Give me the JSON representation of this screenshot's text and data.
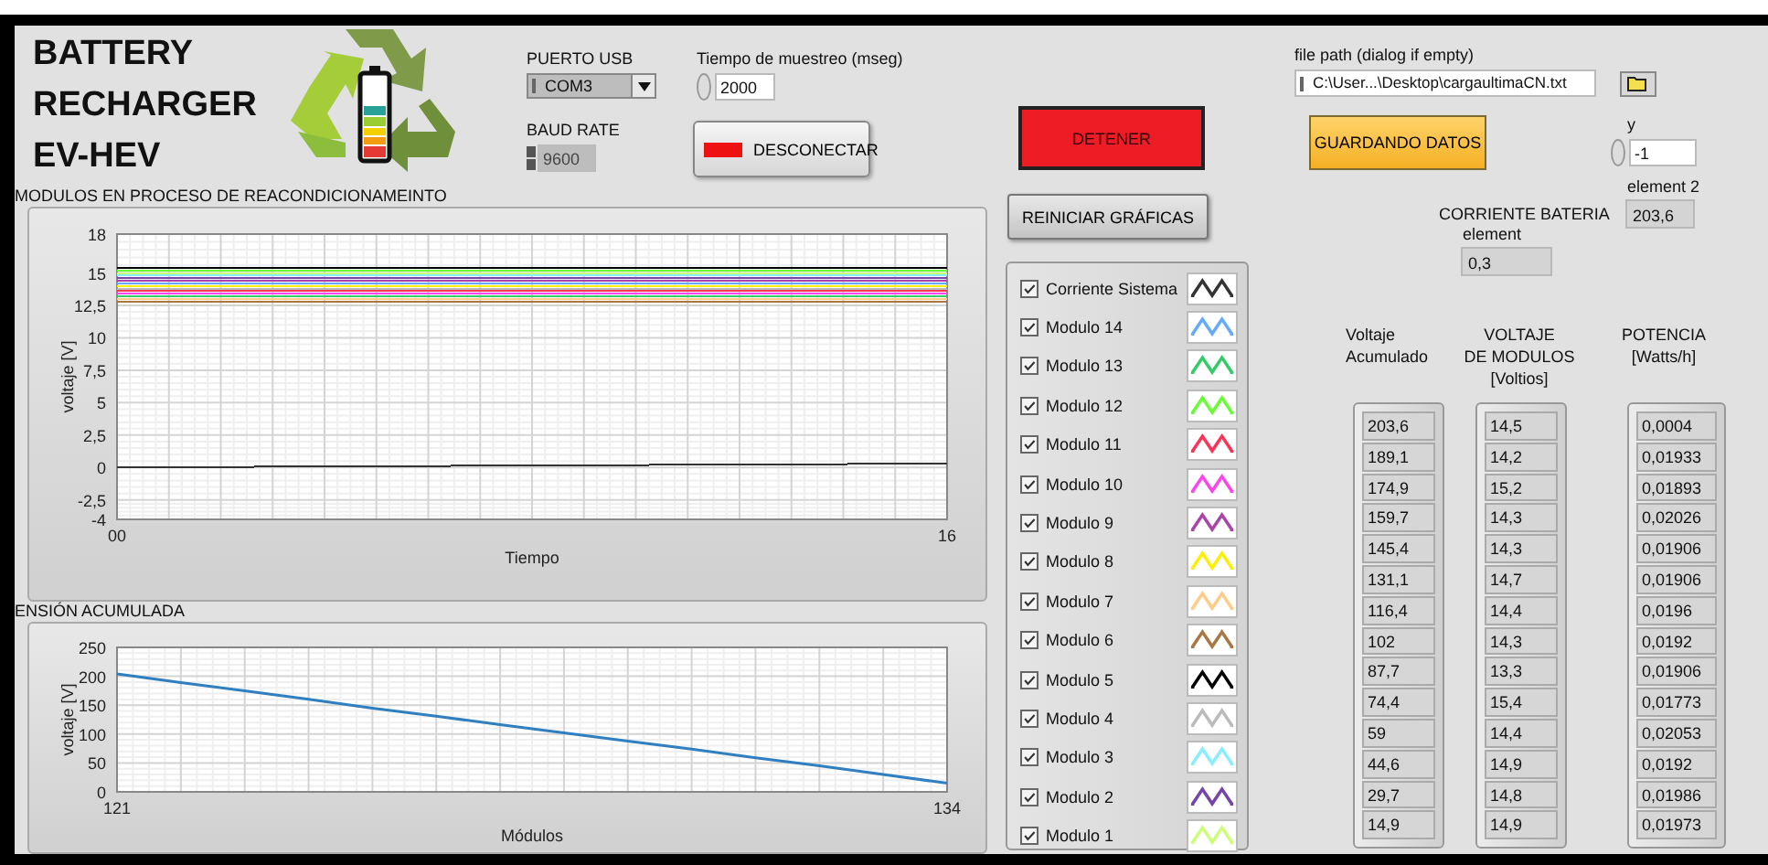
{
  "header": {
    "title": "BATTERY RECHARGER EV-HEV"
  },
  "serial": {
    "port_label": "PUERTO USB",
    "port": "COM3",
    "baud_label": "BAUD RATE",
    "baud": "9600",
    "baud_disabled": true
  },
  "sampling": {
    "label": "Tiempo de muestreo (mseg)",
    "value": "2000"
  },
  "disconnect_button": {
    "label": "DESCONECTAR",
    "on": true
  },
  "stop_button": {
    "label": "DETENER"
  },
  "reset_button": {
    "label": "REINICIAR GRÁFICAS"
  },
  "module_chart": {
    "chart_data": {
      "type": "line",
      "title": "MODULOS EN PROCESO DE REACONDICIONAMEINTO",
      "xlabel": "Tiempo",
      "ylabel": "voltaje [V]",
      "grid": true,
      "x": [
        0,
        16
      ],
      "xlim": [
        0,
        16
      ],
      "ylim": [
        -4,
        18
      ],
      "xticks": [
        {
          "value": 0,
          "label": "00"
        },
        16
      ],
      "yticks": [
        {
          "value": -4,
          "label": "-4"
        },
        {
          "value": -2.5,
          "label": "-2,5"
        },
        0,
        {
          "value": 2.5,
          "label": "2,5"
        },
        5,
        {
          "value": 7.5,
          "label": "7,5"
        },
        10,
        {
          "value": 12.5,
          "label": "12,5"
        },
        15,
        18
      ],
      "series": [
        {
          "color": "#333333",
          "values": [
            0,
            0.3
          ]
        },
        {
          "color": "#66aaff",
          "values": [
            14.2,
            14.2
          ]
        },
        {
          "color": "#33cc66",
          "values": [
            13.2,
            13.2
          ]
        },
        {
          "color": "#66ff33",
          "values": [
            15.2,
            15.2
          ]
        },
        {
          "color": "#ff3355",
          "values": [
            13.6,
            13.6
          ]
        },
        {
          "color": "#ff44ee",
          "values": [
            13.4,
            13.4
          ]
        },
        {
          "color": "#aa44aa",
          "values": [
            14.4,
            14.4
          ]
        },
        {
          "color": "#ffee00",
          "values": [
            14.0,
            14.0
          ]
        },
        {
          "color": "#ffcc88",
          "values": [
            13.0,
            13.0
          ]
        },
        {
          "color": "#aa7744",
          "values": [
            12.8,
            12.8
          ]
        },
        {
          "color": "#000000",
          "values": [
            15.4,
            15.4
          ]
        },
        {
          "color": "#bbbbbb",
          "values": [
            13.8,
            13.8
          ]
        },
        {
          "color": "#88eeff",
          "values": [
            14.8,
            14.8
          ]
        },
        {
          "color": "#7744aa",
          "values": [
            14.6,
            14.6
          ]
        },
        {
          "color": "#ccff77",
          "values": [
            15.0,
            15.0
          ]
        }
      ]
    }
  },
  "accumulated_chart": {
    "chart_data": {
      "type": "line",
      "title": "ENSIÓN ACUMULADA",
      "xlabel": "Módulos",
      "ylabel": "voltaje [V]",
      "grid": true,
      "x": [
        121,
        122,
        123,
        124,
        125,
        126,
        127,
        128,
        129,
        130,
        131,
        132,
        133,
        134
      ],
      "xlim": [
        121,
        134
      ],
      "ylim": [
        0,
        250
      ],
      "xticks": [
        121,
        134
      ],
      "yticks": [
        0,
        50,
        100,
        150,
        200,
        250
      ],
      "series": [
        {
          "color": "#2f7fc1",
          "values": [
            204,
            189,
            175,
            160,
            145,
            131,
            116,
            102,
            88,
            74,
            59,
            45,
            30,
            15
          ]
        }
      ]
    }
  },
  "legend": {
    "items": [
      {
        "label": "Corriente Sistema",
        "checked": true,
        "color": "#333333"
      },
      {
        "label": "Modulo 14",
        "checked": true,
        "color": "#66aaff"
      },
      {
        "label": "Modulo 13",
        "checked": true,
        "color": "#33cc66"
      },
      {
        "label": "Modulo 12",
        "checked": true,
        "color": "#66ff33"
      },
      {
        "label": "Modulo 11",
        "checked": true,
        "color": "#ff3355"
      },
      {
        "label": "Modulo 10",
        "checked": true,
        "color": "#ff44ee"
      },
      {
        "label": "Modulo 9",
        "checked": true,
        "color": "#aa44aa"
      },
      {
        "label": "Modulo 8",
        "checked": true,
        "color": "#ffee00"
      },
      {
        "label": "Modulo 7",
        "checked": true,
        "color": "#ffcc88"
      },
      {
        "label": "Modulo 6",
        "checked": true,
        "color": "#aa7744"
      },
      {
        "label": "Modulo 5",
        "checked": true,
        "color": "#000000"
      },
      {
        "label": "Modulo 4",
        "checked": true,
        "color": "#bbbbbb"
      },
      {
        "label": "Modulo 3",
        "checked": true,
        "color": "#88eeff"
      },
      {
        "label": "Modulo 2",
        "checked": true,
        "color": "#7744aa"
      },
      {
        "label": "Modulo 1",
        "checked": true,
        "color": "#ccff77"
      }
    ]
  },
  "file_path": {
    "label": "file path (dialog if empty)",
    "value": "C:\\User...\\Desktop\\cargaultimaCN.txt"
  },
  "save_button": {
    "label": "GUARDANDO DATOS",
    "on": true
  },
  "y_control": {
    "label": "y",
    "value": "-1"
  },
  "element_2": {
    "label": "element 2",
    "value": "203,6"
  },
  "battery_current": {
    "label": "CORRIENTE BATERIA",
    "element_label": "element",
    "value": "0,3"
  },
  "arrays": [
    {
      "header": "Voltaje\nAcumulado",
      "values": [
        "203,6",
        "189,1",
        "174,9",
        "159,7",
        "145,4",
        "131,1",
        "116,4",
        "102",
        "87,7",
        "74,4",
        "59",
        "44,6",
        "29,7",
        "14,9"
      ]
    },
    {
      "header": "VOLTAJE\nDE MODULOS\n[Voltios]",
      "values": [
        "14,5",
        "14,2",
        "15,2",
        "14,3",
        "14,3",
        "14,7",
        "14,4",
        "14,3",
        "13,3",
        "15,4",
        "14,4",
        "14,9",
        "14,8",
        "14,9"
      ]
    },
    {
      "header": "POTENCIA\n[Watts/h]",
      "values": [
        "0,0004",
        "0,01933",
        "0,01893",
        "0,02026",
        "0,01906",
        "0,01906",
        "0,0196",
        "0,0192",
        "0,01906",
        "0,01773",
        "0,02053",
        "0,0192",
        "0,01986",
        "0,01973"
      ]
    }
  ]
}
